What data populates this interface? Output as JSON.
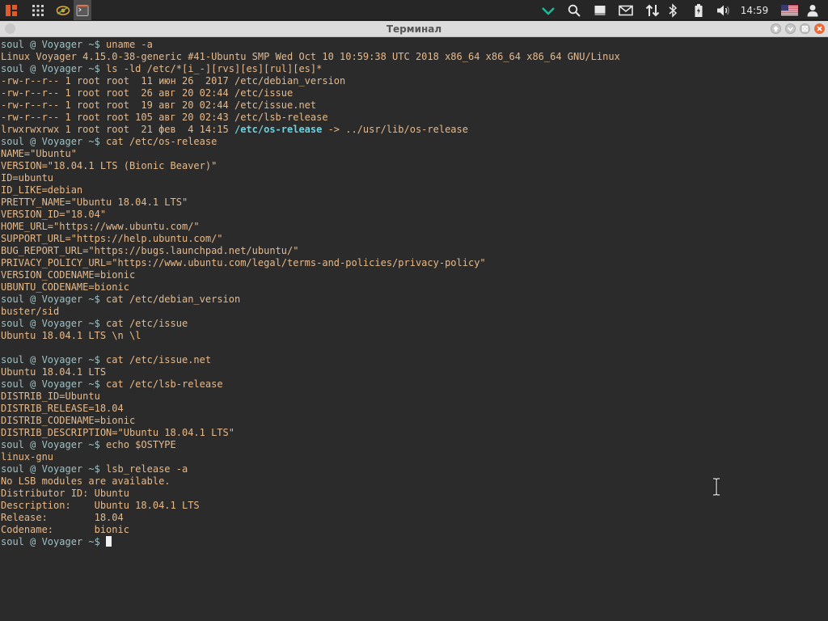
{
  "panel": {
    "clock": "14:59",
    "icons": [
      "app-menu-icon",
      "apps-grid-icon",
      "eye-app-icon",
      "terminal-app-icon",
      "checkmark-icon",
      "search-icon",
      "notes-icon",
      "mail-icon",
      "network-icon",
      "bluetooth-icon",
      "battery-icon",
      "volume-icon",
      "us-flag-icon",
      "user-icon"
    ],
    "accent_color": "#e05a2b",
    "check_color": "#1abc9c"
  },
  "window": {
    "title": "Терминал"
  },
  "terminal": {
    "prompt": "soul @ Voyager ~$ ",
    "lines": [
      {
        "type": "cmd",
        "text": "uname -a"
      },
      {
        "type": "out",
        "text": "Linux Voyager 4.15.0-38-generic #41-Ubuntu SMP Wed Oct 10 10:59:38 UTC 2018 x86_64 x86_64 x86_64 GNU/Linux"
      },
      {
        "type": "cmd",
        "text": "ls -ld /etc/*[i_-][rvs][es][rul][es]*"
      },
      {
        "type": "out",
        "text": "-rw-r--r-- 1 root root  11 июн 26  2017 /etc/debian_version"
      },
      {
        "type": "out",
        "text": "-rw-r--r-- 1 root root  26 авг 20 02:44 /etc/issue"
      },
      {
        "type": "out",
        "text": "-rw-r--r-- 1 root root  19 авг 20 02:44 /etc/issue.net"
      },
      {
        "type": "out",
        "text": "-rw-r--r-- 1 root root 105 авг 20 02:43 /etc/lsb-release"
      },
      {
        "type": "link",
        "pre": "lrwxrwxrwx 1 root root  21 фев  4 14:15 ",
        "link": "/etc/os-release",
        "post": " -> ../usr/lib/os-release"
      },
      {
        "type": "cmd",
        "text": "cat /etc/os-release"
      },
      {
        "type": "out",
        "text": "NAME=\"Ubuntu\""
      },
      {
        "type": "out",
        "text": "VERSION=\"18.04.1 LTS (Bionic Beaver)\""
      },
      {
        "type": "out",
        "text": "ID=ubuntu"
      },
      {
        "type": "out",
        "text": "ID_LIKE=debian"
      },
      {
        "type": "out",
        "text": "PRETTY_NAME=\"Ubuntu 18.04.1 LTS\""
      },
      {
        "type": "out",
        "text": "VERSION_ID=\"18.04\""
      },
      {
        "type": "out",
        "text": "HOME_URL=\"https://www.ubuntu.com/\""
      },
      {
        "type": "out",
        "text": "SUPPORT_URL=\"https://help.ubuntu.com/\""
      },
      {
        "type": "out",
        "text": "BUG_REPORT_URL=\"https://bugs.launchpad.net/ubuntu/\""
      },
      {
        "type": "out",
        "text": "PRIVACY_POLICY_URL=\"https://www.ubuntu.com/legal/terms-and-policies/privacy-policy\""
      },
      {
        "type": "out",
        "text": "VERSION_CODENAME=bionic"
      },
      {
        "type": "out",
        "text": "UBUNTU_CODENAME=bionic"
      },
      {
        "type": "cmd",
        "text": "cat /etc/debian_version"
      },
      {
        "type": "out",
        "text": "buster/sid"
      },
      {
        "type": "cmd",
        "text": "cat /etc/issue"
      },
      {
        "type": "out",
        "text": "Ubuntu 18.04.1 LTS \\n \\l"
      },
      {
        "type": "out",
        "text": ""
      },
      {
        "type": "cmd",
        "text": "cat /etc/issue.net"
      },
      {
        "type": "out",
        "text": "Ubuntu 18.04.1 LTS"
      },
      {
        "type": "cmd",
        "text": "cat /etc/lsb-release"
      },
      {
        "type": "out",
        "text": "DISTRIB_ID=Ubuntu"
      },
      {
        "type": "out",
        "text": "DISTRIB_RELEASE=18.04"
      },
      {
        "type": "out",
        "text": "DISTRIB_CODENAME=bionic"
      },
      {
        "type": "out",
        "text": "DISTRIB_DESCRIPTION=\"Ubuntu 18.04.1 LTS\""
      },
      {
        "type": "cmd",
        "text": "echo $OSTYPE"
      },
      {
        "type": "out",
        "text": "linux-gnu"
      },
      {
        "type": "cmd",
        "text": "lsb_release -a"
      },
      {
        "type": "out",
        "text": "No LSB modules are available."
      },
      {
        "type": "out",
        "text": "Distributor ID:\tUbuntu"
      },
      {
        "type": "out",
        "text": "Description:\tUbuntu 18.04.1 LTS"
      },
      {
        "type": "out",
        "text": "Release:\t18.04"
      },
      {
        "type": "out",
        "text": "Codename:\tbionic"
      },
      {
        "type": "cursor",
        "text": ""
      }
    ]
  }
}
